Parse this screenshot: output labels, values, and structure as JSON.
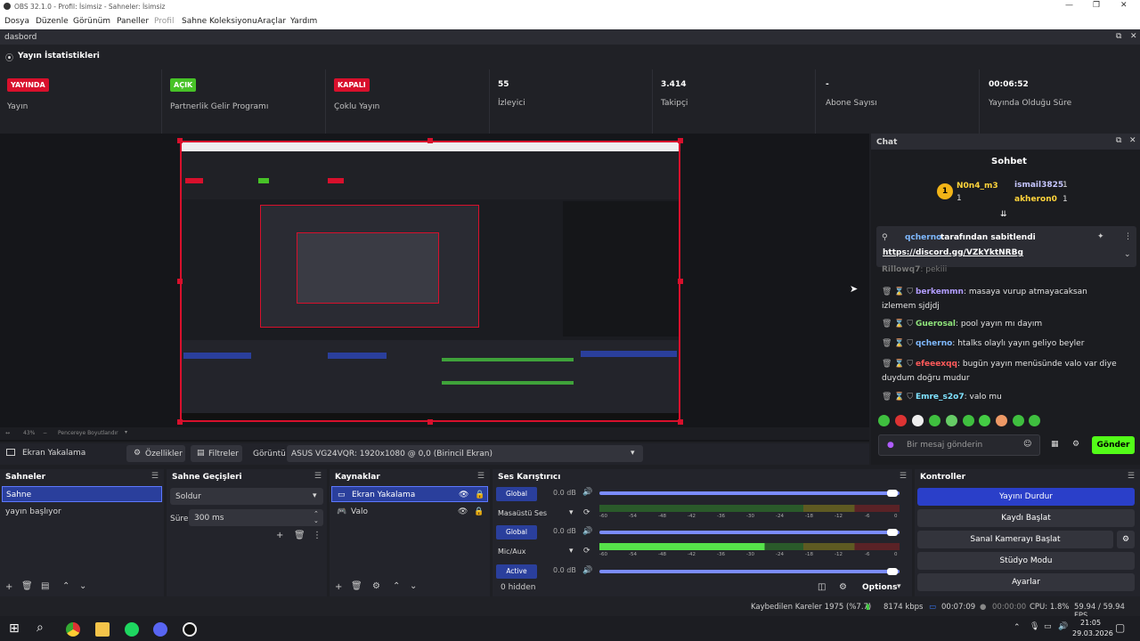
{
  "window": {
    "title": "OBS 32.1.0 - Profil: İsimsiz - Sahneler: İsimsiz",
    "min": "—",
    "max": "❐",
    "close": "✕"
  },
  "menu": [
    "Dosya",
    "Düzenle",
    "Görünüm",
    "Paneller",
    "Profil",
    "Sahne Koleksiyonu",
    "Araçlar",
    "Yardım"
  ],
  "dock": {
    "name": "dasbord",
    "title": "Yayın İstatistikleri"
  },
  "stats": [
    {
      "badge": "YAYINDA",
      "badge_color": "#d8102c",
      "label": "Yayın"
    },
    {
      "badge": "AÇIK",
      "badge_color": "#47c227",
      "label": "Partnerlik Gelir Programı"
    },
    {
      "badge": "KAPALI",
      "badge_color": "#d8102c",
      "label": "Çoklu Yayın"
    },
    {
      "value": "55",
      "label": "İzleyici"
    },
    {
      "value": "3.414",
      "label": "Takipçi"
    },
    {
      "value": "-",
      "label": "Abone Sayısı"
    },
    {
      "value": "00:06:52",
      "label": "Yayında Olduğu Süre"
    }
  ],
  "chat": {
    "dock_title": "Chat",
    "title": "Sohbet",
    "top_users": [
      {
        "name": "N0n4_m3",
        "count": "1"
      },
      {
        "name": "ismail3825",
        "count": "1"
      },
      {
        "name": "akheron0",
        "count": "1"
      }
    ],
    "pinned_by": "qcherno",
    "pinned_text": "tarafından sabitlendi",
    "pinned_link": "https://discord.gg/VZkYktNRBg",
    "partial_user": "Rillowq7",
    "partial_msg": ": pekiii",
    "messages": [
      {
        "user": "berkemmn",
        "color": "#b29dff",
        "text": ": masaya vurup atmayacaksan izlemem sjdjdj"
      },
      {
        "user": "Guerosal",
        "color": "#8fe37b",
        "text": ": pool yayın mı dayım"
      },
      {
        "user": "qcherno",
        "color": "#7fb9ff",
        "text": ": htalks olaylı yayın geliyo beyler"
      },
      {
        "user": "efeeexqq",
        "color": "#ff5a5a",
        "text": ": bugün yayın menüsünde valo var diye duydum doğru mudur"
      },
      {
        "user": "Emre_s2o7",
        "color": "#7fe3ff",
        "text": ": valo mu"
      }
    ],
    "input_placeholder": "Bir mesaj gönderin",
    "send": "Gönder"
  },
  "preview": {
    "zoom": "43%",
    "fit": "Pencereye Boyutlandır"
  },
  "propbar": {
    "source": "Ekran Yakalama",
    "props": "Özellikler",
    "filters": "Filtreler",
    "display_label": "Görüntü",
    "display_value": "ASUS VG24VQR: 1920x1080 @ 0,0 (Birincil Ekran)"
  },
  "scenes": {
    "title": "Sahneler",
    "items": [
      "Sahne",
      "yayın başlıyor"
    ]
  },
  "transitions": {
    "title": "Sahne Geçişleri",
    "type": "Soldur",
    "duration_label": "Süre",
    "duration": "300 ms"
  },
  "sources": {
    "title": "Kaynaklar",
    "items": [
      "Ekran Yakalama",
      "Valo"
    ]
  },
  "mixer": {
    "title": "Ses Karıştırıcı",
    "tracks": [
      {
        "badge": "Global",
        "db": "0.0 dB",
        "name": "Masaüstü Ses",
        "level": 0.0
      },
      {
        "badge": "Global",
        "db": "0.0 dB",
        "name": "Mic/Aux",
        "level": 0.55
      },
      {
        "badge": "Active",
        "db": "0.0 dB",
        "name": ""
      }
    ],
    "scale": [
      "-60",
      "-54",
      "-48",
      "-42",
      "-36",
      "-30",
      "-24",
      "-18",
      "-12",
      "-6",
      "0"
    ],
    "hidden": "0 hidden",
    "options": "Options"
  },
  "controls": {
    "title": "Kontroller",
    "buttons": [
      "Yayını Durdur",
      "Kaydı Başlat",
      "Sanal Kamerayı Başlat",
      "Stüdyo Modu",
      "Ayarlar"
    ]
  },
  "status": {
    "dropped": "Kaybedilen Kareler 1975 (%7.7)",
    "bitrate": "8174 kbps",
    "stream_time": "00:07:09",
    "rec_time": "00:00:00",
    "cpu": "CPU: 1.8%",
    "fps": "59.94 / 59.94 FPS"
  },
  "taskbar": {
    "time": "21:05",
    "date": "29.03.2026"
  }
}
